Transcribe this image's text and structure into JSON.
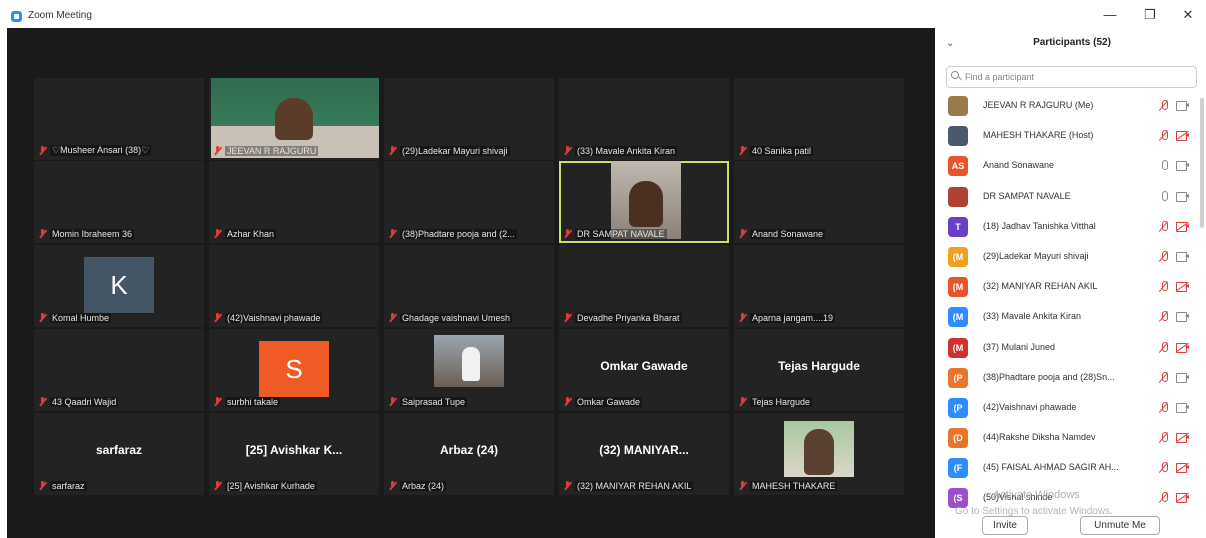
{
  "window": {
    "title": "Zoom Meeting",
    "minimize": "—",
    "maximize": "❐",
    "close": "✕"
  },
  "colors": {
    "accent": "#2d8cff",
    "muted": "#e23b3b",
    "active_speaker": "#c7e364"
  },
  "gallery": [
    {
      "name": "♡Musheer Ansari (38)♡"
    },
    {
      "name": "JEEVAN R RAJGURU",
      "video": "jeevan"
    },
    {
      "name": "(29)Ladekar Mayuri shivaji"
    },
    {
      "name": "(33) Mavale Ankita Kiran"
    },
    {
      "name": "40 Sanika patil"
    },
    {
      "name": "Momin Ibraheem 36"
    },
    {
      "name": "Azhar Khan"
    },
    {
      "name": "(38)Phadtare pooja and (2..."
    },
    {
      "name": "DR SAMPAT NAVALE",
      "video": "sampat",
      "active": true
    },
    {
      "name": "Anand Sonawane"
    },
    {
      "name": "Komal Humbe",
      "avatar": "K",
      "avatar_color": "#445566"
    },
    {
      "name": "(42)Vaishnavi phawade"
    },
    {
      "name": "Ghadage vaishnavi Umesh"
    },
    {
      "name": "Devadhe Priyanka Bharat"
    },
    {
      "name": "Aparna jangam....19"
    },
    {
      "name": "43 Qaadri Wajid"
    },
    {
      "name": "surbhi takale",
      "avatar": "S",
      "avatar_color": "#ef5b24"
    },
    {
      "name": "Saiprasad Tupe",
      "video": "saiprasad"
    },
    {
      "name": "Omkar Gawade",
      "big": "Omkar Gawade"
    },
    {
      "name": "Tejas Hargude",
      "big": "Tejas Hargude"
    },
    {
      "name": "sarfaraz",
      "big": "sarfaraz"
    },
    {
      "name": "[25] Avishkar Kurhade",
      "big": "[25] Avishkar K..."
    },
    {
      "name": "Arbaz (24)",
      "big": "Arbaz (24)"
    },
    {
      "name": "(32) MANIYAR REHAN AKIL",
      "big": "(32) MANIYAR..."
    },
    {
      "name": "MAHESH THAKARE",
      "video": "mahesh"
    }
  ],
  "panel": {
    "title": "Participants (52)",
    "search_placeholder": "Find a participant",
    "participants": [
      {
        "name": "JEEVAN R RAJGURU (Me)",
        "avatar": "",
        "color": "#9b7a4a",
        "mic": "muted",
        "cam": "on"
      },
      {
        "name": "MAHESH THAKARE (Host)",
        "avatar": "",
        "color": "#4a5a6a",
        "mic": "muted",
        "cam": "off"
      },
      {
        "name": "Anand Sonawane",
        "avatar": "AS",
        "color": "#e9542a",
        "mic": "on",
        "cam": "on"
      },
      {
        "name": "DR SAMPAT NAVALE",
        "avatar": "",
        "color": "#b04030",
        "mic": "on",
        "cam": "on"
      },
      {
        "name": "(18) Jadhav Tanishka Vitthal",
        "avatar": "T",
        "color": "#6a3fc8",
        "mic": "muted",
        "cam": "off"
      },
      {
        "name": "(29)Ladekar Mayuri shivaji",
        "avatar": "(M",
        "color": "#f0a020",
        "mic": "muted",
        "cam": "on"
      },
      {
        "name": "(32) MANIYAR REHAN AKIL",
        "avatar": "(M",
        "color": "#e9542a",
        "mic": "muted",
        "cam": "off"
      },
      {
        "name": "(33) Mavale Ankita Kiran",
        "avatar": "(M",
        "color": "#2d8cff",
        "mic": "muted",
        "cam": "on"
      },
      {
        "name": "(37) Mulani Juned",
        "avatar": "(M",
        "color": "#d03030",
        "mic": "muted",
        "cam": "off"
      },
      {
        "name": "(38)Phadtare pooja and (28)Sn...",
        "avatar": "(P",
        "color": "#e9742a",
        "mic": "muted",
        "cam": "on"
      },
      {
        "name": "(42)Vaishnavi phawade",
        "avatar": "(P",
        "color": "#2d8cff",
        "mic": "muted",
        "cam": "on"
      },
      {
        "name": "(44)Rakshe Diksha Namdev",
        "avatar": "(D",
        "color": "#e9742a",
        "mic": "muted",
        "cam": "off"
      },
      {
        "name": "(45) FAISAL AHMAD SAGIR AH...",
        "avatar": "(F",
        "color": "#2d8cff",
        "mic": "muted",
        "cam": "off"
      },
      {
        "name": "(50)Vishal shinde",
        "avatar": "(S",
        "color": "#9b4fc8",
        "mic": "muted",
        "cam": "off"
      }
    ],
    "watermark_1": "Activate Windows",
    "watermark_2": "Go to Settings to activate Windows.",
    "invite": "Invite",
    "unmute_me": "Unmute Me"
  }
}
